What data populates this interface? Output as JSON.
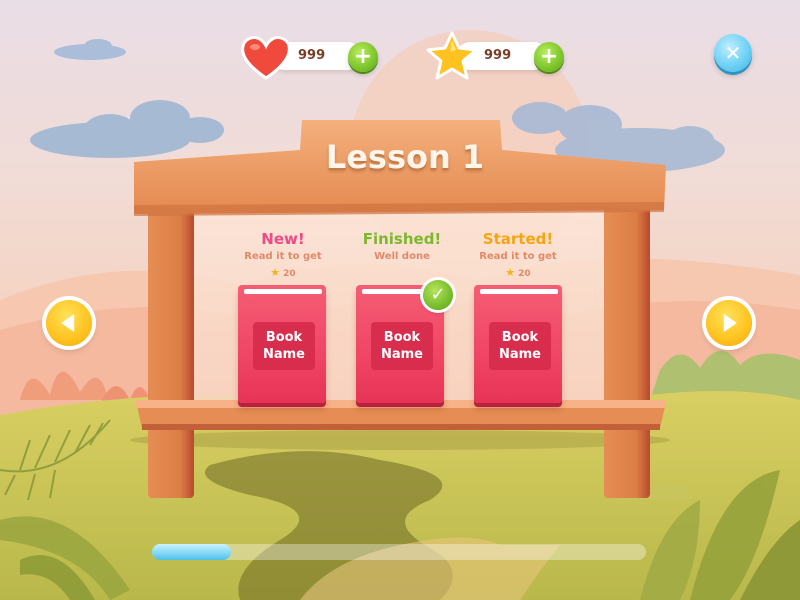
{
  "hud": {
    "lives": {
      "icon": "heart-icon",
      "value": "999",
      "add_icon": "plus-icon"
    },
    "stars": {
      "icon": "star-icon",
      "value": "999",
      "add_icon": "plus-icon"
    },
    "close_icon": "close-icon"
  },
  "lesson": {
    "title": "Lesson 1",
    "books": [
      {
        "status": "New!",
        "status_color": "#ef4a86",
        "subtitle": "Read it to get",
        "reward": "20",
        "name_line1": "Book",
        "name_line2": "Name",
        "completed": false
      },
      {
        "status": "Finished!",
        "status_color": "#7cb82d",
        "subtitle": "Well done",
        "reward": "",
        "name_line1": "Book",
        "name_line2": "Name",
        "completed": true
      },
      {
        "status": "Started!",
        "status_color": "#f5a511",
        "subtitle": "Read it to get",
        "reward": "20",
        "name_line1": "Book",
        "name_line2": "Name",
        "completed": false
      }
    ]
  },
  "navigation": {
    "prev_icon": "arrow-left-icon",
    "next_icon": "arrow-right-icon"
  },
  "progress": {
    "fraction": 0.16
  },
  "colors": {
    "accent_yellow": "#ffc21f",
    "book_red": "#f04565",
    "plus_green": "#7dc42c",
    "close_blue": "#6fd1f5",
    "wood": "#e9935a"
  }
}
